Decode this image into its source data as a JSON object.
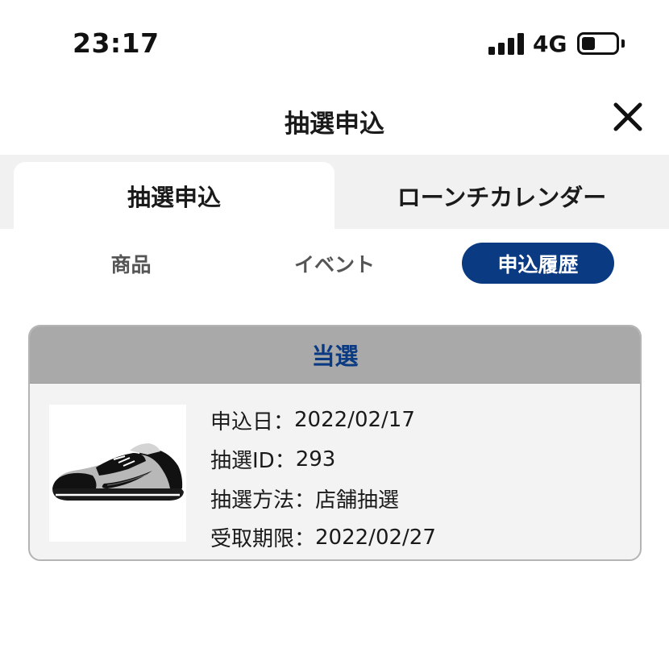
{
  "status_bar": {
    "time": "23:17",
    "network": "4G",
    "icons": [
      "signal-icon",
      "battery-icon"
    ]
  },
  "header": {
    "title": "抽選申込",
    "close_icon": "close-icon"
  },
  "main_tabs": [
    {
      "label": "抽選申込",
      "active": true
    },
    {
      "label": "ローンチカレンダー",
      "active": false
    }
  ],
  "sub_tabs": [
    {
      "label": "商品",
      "active": false
    },
    {
      "label": "イベント",
      "active": false
    },
    {
      "label": "申込履歴",
      "active": true
    }
  ],
  "entry": {
    "status": "当選",
    "image_icon": "sneaker-image",
    "fields": [
      {
        "label": "申込日：",
        "value": "2022/02/17"
      },
      {
        "label": "抽選ID：",
        "value": "293"
      },
      {
        "label": "抽選方法：",
        "value": "店舗抽選"
      },
      {
        "label": "受取期限：",
        "value": "2022/02/27"
      }
    ]
  },
  "colors": {
    "accent": "#0a3a82",
    "card_header": "#a9a9a9",
    "card_body": "#f3f3f3",
    "tab_bar": "#f1f1f1"
  }
}
